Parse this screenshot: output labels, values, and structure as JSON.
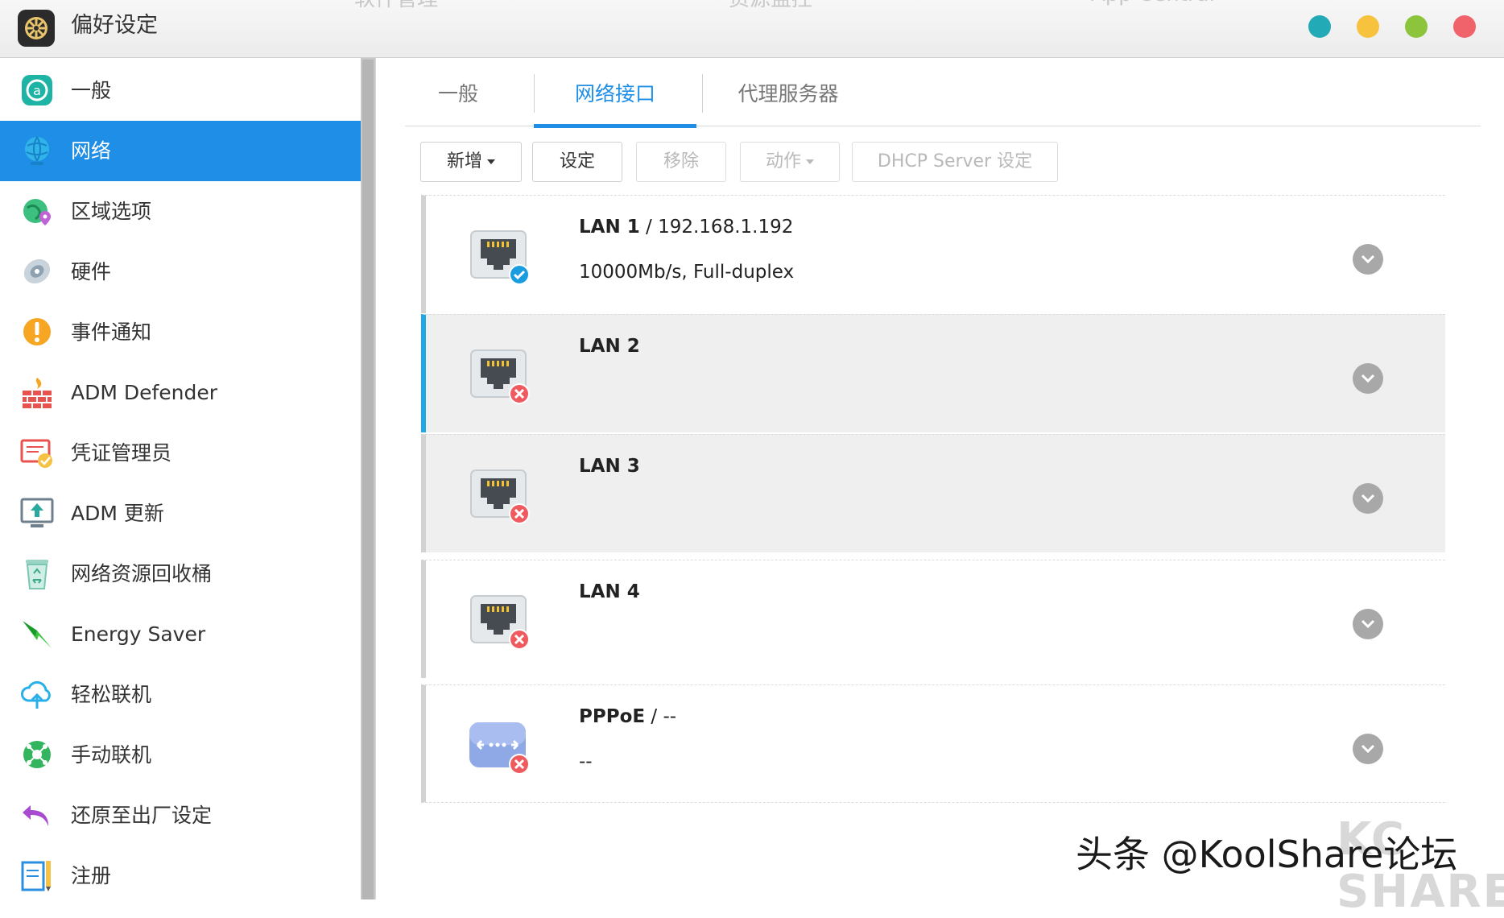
{
  "window": {
    "title": "偏好设定",
    "ghost_tabs": [
      "软件管理",
      "资源监控",
      "App Central"
    ],
    "buttons": [
      {
        "name": "minimize",
        "color": "#22aab7"
      },
      {
        "name": "restore",
        "color": "#f7c23d"
      },
      {
        "name": "maximize",
        "color": "#8cc43c"
      },
      {
        "name": "close",
        "color": "#f0636a"
      }
    ]
  },
  "sidebar": {
    "items": [
      {
        "label": "一般",
        "icon": "general-icon"
      },
      {
        "label": "网络",
        "icon": "globe-icon",
        "active": true
      },
      {
        "label": "区域选项",
        "icon": "region-icon"
      },
      {
        "label": "硬件",
        "icon": "hardware-icon"
      },
      {
        "label": "事件通知",
        "icon": "alert-icon"
      },
      {
        "label": "ADM Defender",
        "icon": "firewall-icon"
      },
      {
        "label": "凭证管理员",
        "icon": "certificate-icon"
      },
      {
        "label": "ADM 更新",
        "icon": "update-icon"
      },
      {
        "label": "网络资源回收桶",
        "icon": "recycle-bin-icon"
      },
      {
        "label": "Energy Saver",
        "icon": "energy-icon"
      },
      {
        "label": "轻松联机",
        "icon": "cloud-connect-icon"
      },
      {
        "label": "手动联机",
        "icon": "manual-connect-icon"
      },
      {
        "label": "还原至出厂设定",
        "icon": "reset-icon"
      },
      {
        "label": "注册",
        "icon": "register-icon"
      }
    ]
  },
  "tabs": [
    {
      "label": "一般"
    },
    {
      "label": "网络接口",
      "active": true
    },
    {
      "label": "代理服务器"
    }
  ],
  "toolbar": {
    "add_label": "新增",
    "settings_label": "设定",
    "remove_label": "移除",
    "action_label": "动作",
    "dhcp_label": "DHCP Server 设定"
  },
  "interfaces": [
    {
      "name": "LAN 1",
      "detail": " / 192.168.1.192",
      "sub": "10000Mb/s, Full-duplex",
      "status": "connected",
      "icon": "ethernet-port-icon"
    },
    {
      "name": "LAN 2",
      "detail": "",
      "sub": "",
      "status": "disconnected",
      "icon": "ethernet-port-icon"
    },
    {
      "name": "LAN 3",
      "detail": "",
      "sub": "",
      "status": "disconnected",
      "icon": "ethernet-port-icon"
    },
    {
      "name": "LAN 4",
      "detail": "",
      "sub": "",
      "status": "disconnected",
      "icon": "ethernet-port-icon"
    },
    {
      "name": "PPPoE",
      "detail": " / --",
      "sub": "--",
      "status": "disconnected",
      "icon": "pppoe-icon"
    }
  ],
  "colors": {
    "accent": "#1f8ee6",
    "connected": "#1a9de0",
    "disconnected": "#ef5a5f"
  },
  "watermark": {
    "text": "头条 @KoolShare论坛",
    "logo": "KC SHARE"
  }
}
